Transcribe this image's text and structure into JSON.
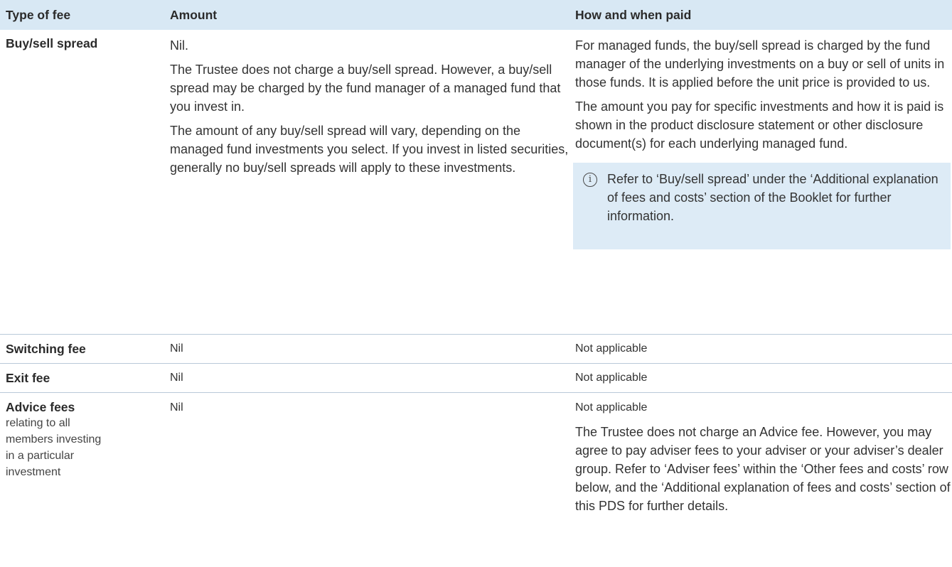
{
  "headers": {
    "type_of_fee": "Type of fee",
    "amount": "Amount",
    "how_when_paid": "How and when paid"
  },
  "buy_sell": {
    "label": "Buy/sell spread",
    "amount_p1": "Nil.",
    "amount_p2": "The Trustee does not charge a buy/sell spread. However, a buy/sell spread may be charged by the fund manager of a managed fund that you invest in.",
    "amount_p3": "The amount of any buy/sell spread will vary, depending on the managed fund investments you select. If you invest in listed securities, generally no buy/sell spreads will apply to these investments.",
    "how_p1": "For managed funds, the buy/sell spread is charged by the fund manager of the underlying investments on a buy or sell of units in those funds. It is applied before the unit price is provided to us.",
    "how_p2": "The amount you pay for specific investments and how it is paid is shown in the product disclosure statement or other disclosure document(s) for each underlying managed fund.",
    "callout_icon": "info-icon",
    "callout_text": "Refer to ‘Buy/sell spread’ under the ‘Additional explanation of fees and costs’ section of the Booklet for further information."
  },
  "switching": {
    "label": "Switching fee",
    "amount": "Nil",
    "how": "Not applicable"
  },
  "exit": {
    "label": "Exit fee",
    "amount": "Nil",
    "how": "Not applicable"
  },
  "advice": {
    "label": "Advice fees",
    "sublabel": "relating to all members investing in a particular investment",
    "amount": "Nil",
    "how_p1": "Not applicable",
    "how_p2": "The Trustee does not charge an Advice fee. However, you may agree to pay adviser fees to your adviser or your adviser’s dealer group. Refer to ‘Adviser fees’ within the ‘Other fees and costs’ row below, and the ‘Additional explanation of fees and costs’ section of this PDS for further details."
  },
  "colors": {
    "header_bg": "#d8e8f4",
    "callout_bg": "#ddebf6",
    "rule": "#b9c9d9"
  }
}
